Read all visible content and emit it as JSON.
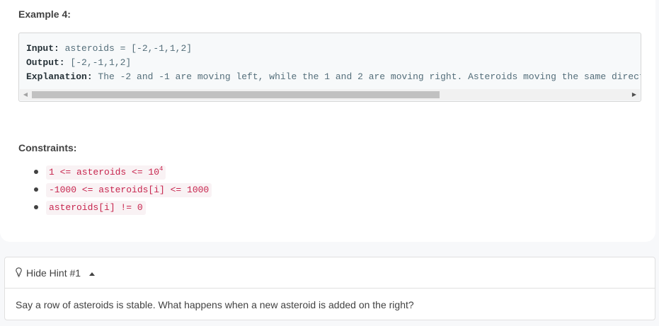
{
  "example": {
    "title": "Example 4:",
    "input_label": "Input:",
    "input_value": " asteroids = [-2,-1,1,2]",
    "output_label": "Output:",
    "output_value": " [-2,-1,1,2]",
    "explanation_label": "Explanation:",
    "explanation_value": " The -2 and -1 are moving left, while the 1 and 2 are moving right. Asteroids moving the same directi",
    "scroll_left_icon": "◀",
    "scroll_right_icon": "▶"
  },
  "constraints": {
    "title": "Constraints:",
    "items": [
      {
        "text": "1 <= asteroids <= 10",
        "sup": "4"
      },
      {
        "text": "-1000 <= asteroids[i] <= 1000"
      },
      {
        "text": "asteroids[i] != 0"
      }
    ]
  },
  "hint": {
    "toggle_label": "Hide Hint #1",
    "body": "Say a row of asteroids is stable. What happens when a new asteroid is added on the right?",
    "icon": "lightbulb-icon"
  },
  "colors": {
    "code_text": "#c7254e",
    "code_background": "#f9f2f4",
    "page_background": "#f7f8fa"
  }
}
